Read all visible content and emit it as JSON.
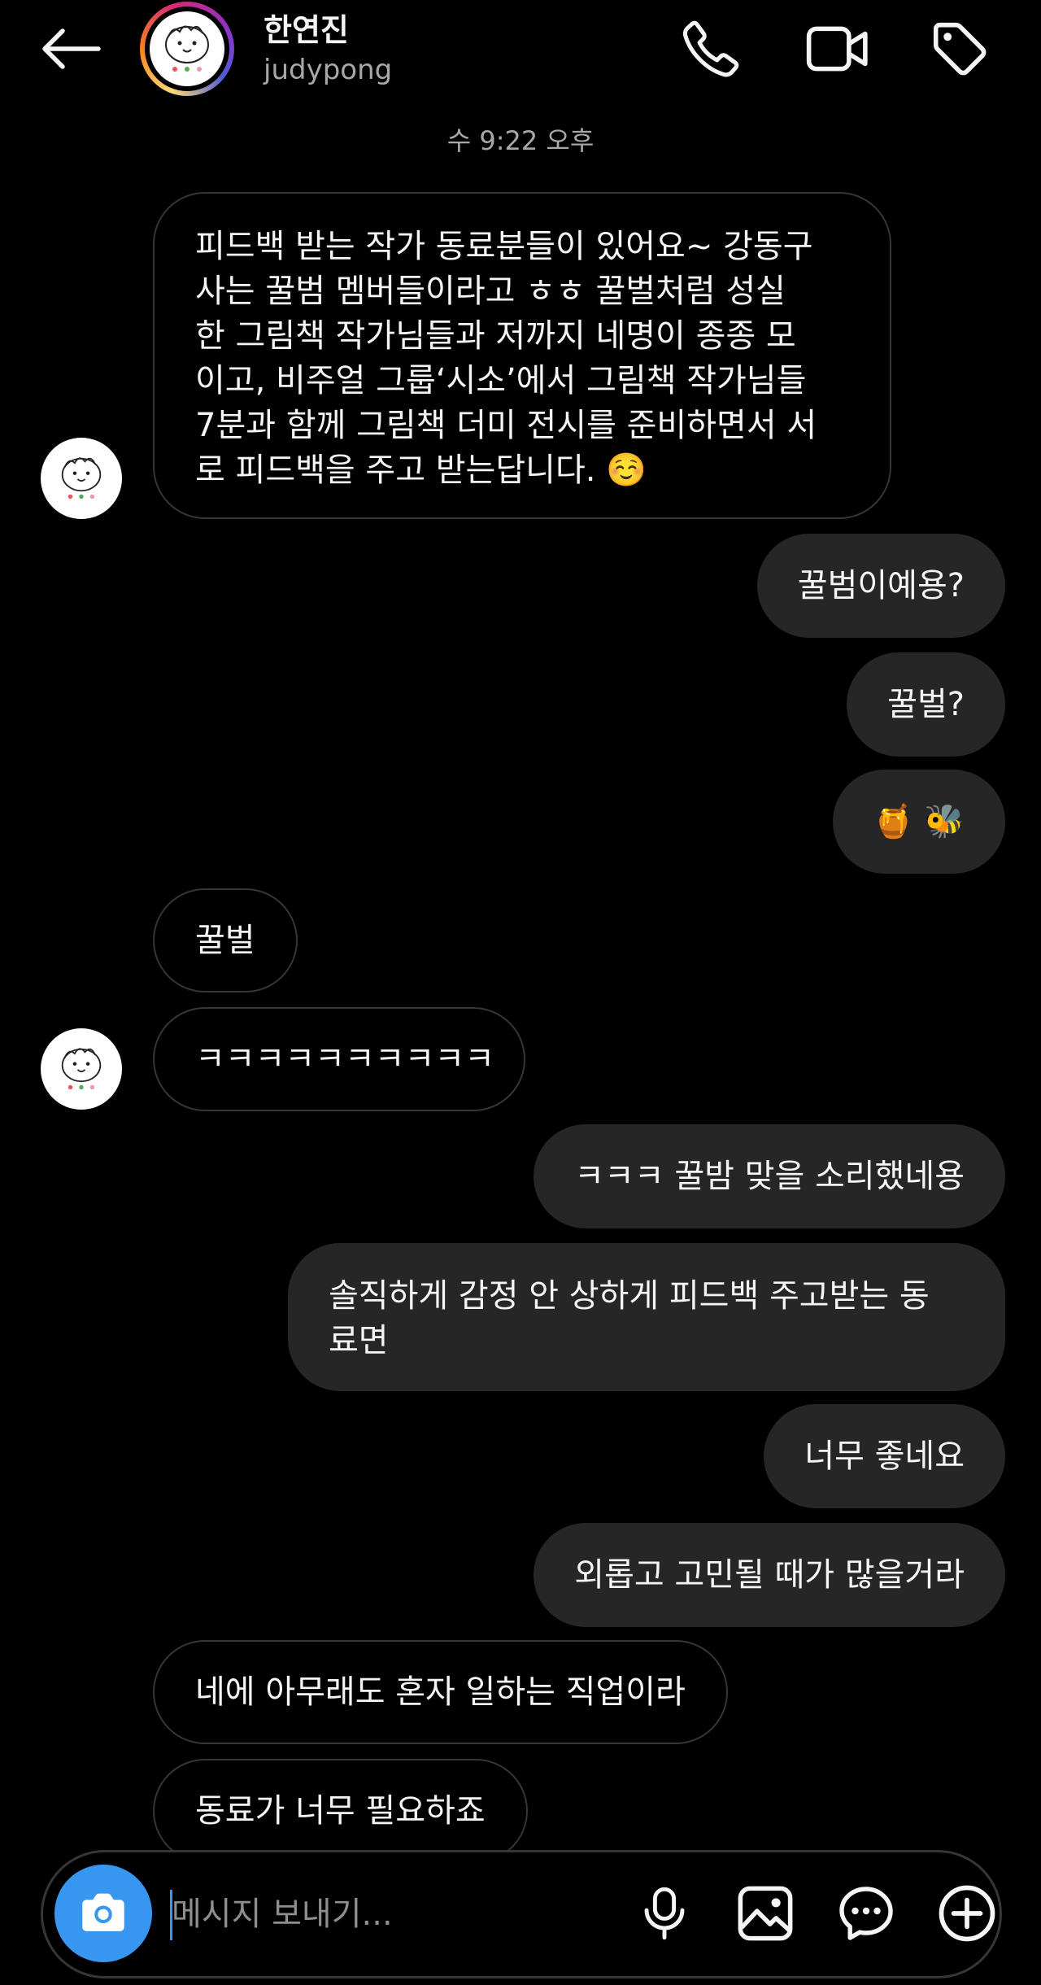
{
  "header": {
    "name": "한연진",
    "username": "judypong"
  },
  "thread": {
    "timestamp": "수 9:22 오후",
    "messages": [
      {
        "side": "in",
        "text": "피드백 받는 작가 동료분들이 있어요~ 강동구\n사는 꿀범 멤버들이라고 ㅎㅎ 꿀벌처럼 성실\n한 그림책 작가님들과 저까지 네명이 종종 모\n이고, 비주얼 그룹‘시소’에서 그림책 작가님들\n7분과 함께 그림책 더미 전시를 준비하면서 서\n로 피드백을 주고 받는답니다. ☺️"
      },
      {
        "side": "out",
        "text": "꿀범이예용?"
      },
      {
        "side": "out",
        "text": "꿀벌?"
      },
      {
        "side": "out",
        "text": "🍯 🐝"
      },
      {
        "side": "in",
        "text": "꿀벌"
      },
      {
        "side": "in",
        "text": "ㅋㅋㅋㅋㅋㅋㅋㅋㅋㅋ"
      },
      {
        "side": "out",
        "text": "ㅋㅋㅋ 꿀밤 맞을 소리했네용"
      },
      {
        "side": "out",
        "text": "솔직하게 감정 안 상하게 피드백 주고받는 동\n료면"
      },
      {
        "side": "out",
        "text": "너무 좋네요"
      },
      {
        "side": "out",
        "text": "외롭고 고민될 때가 많을거라"
      },
      {
        "side": "in",
        "text": "네에 아무래도 혼자 일하는 직업이라"
      },
      {
        "side": "in",
        "text": "동료가 너무 필요하죠"
      }
    ]
  },
  "composer": {
    "placeholder": "메시지 보내기..."
  },
  "icons": {
    "back": "arrow-left-icon",
    "call": "phone-icon",
    "video": "video-camera-icon",
    "tag": "tag-icon",
    "camera": "camera-icon",
    "mic": "microphone-icon",
    "gallery": "image-icon",
    "sticker": "chat-bubble-icon",
    "more": "plus-circle-icon"
  },
  "colors": {
    "background": "#000000",
    "bubble_out": "#262626",
    "bubble_in_border": "#363636",
    "accent": "#3797f0",
    "secondary_text": "#a8a8a8"
  }
}
